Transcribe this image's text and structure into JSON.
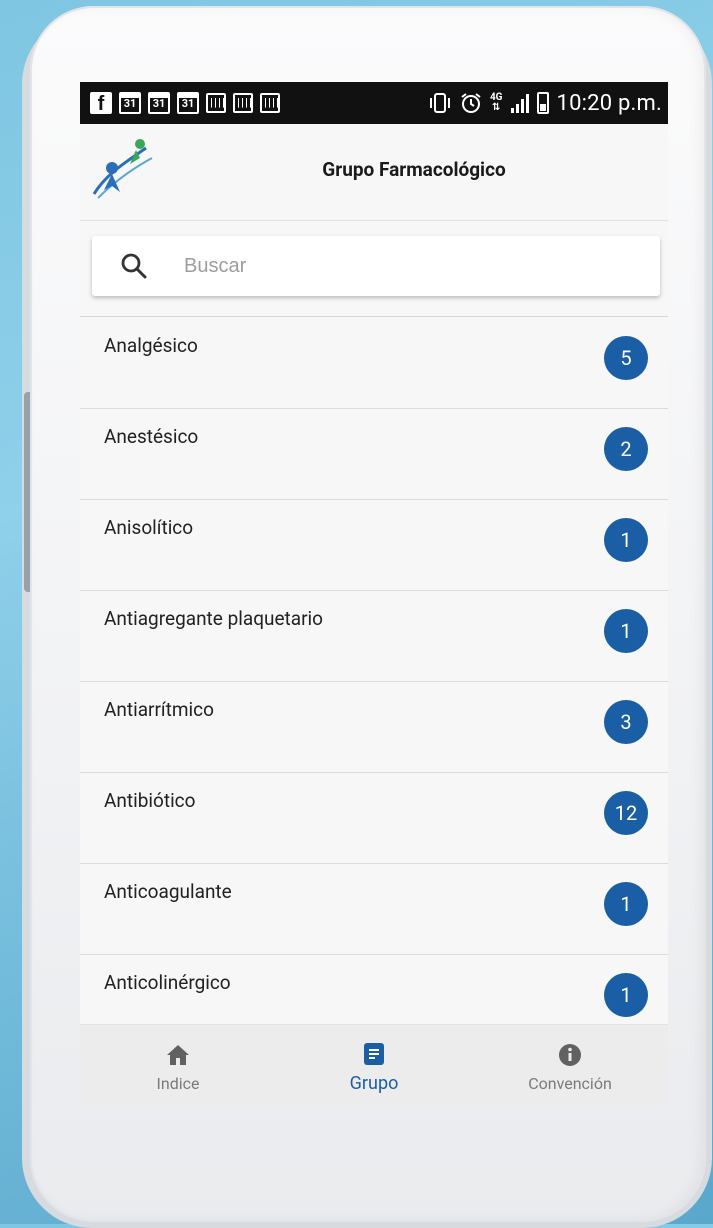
{
  "status_bar": {
    "time": "10:20 p.m.",
    "network_label": "4G",
    "calendar_day": "31",
    "icons": [
      "facebook-icon",
      "calendar-icon",
      "calendar-icon",
      "calendar-icon",
      "calendar-small-icon",
      "calendar-small-icon",
      "calendar-small-icon",
      "vibrate-icon",
      "alarm-icon",
      "network-4g-icon",
      "signal-icon",
      "battery-icon"
    ]
  },
  "header": {
    "title": "Grupo Farmacológico",
    "logo": "app-logo-icon"
  },
  "search": {
    "placeholder": "Buscar",
    "value": "",
    "icon": "search-icon"
  },
  "list": {
    "items": [
      {
        "label": "Analgésico",
        "count": "5"
      },
      {
        "label": "Anestésico",
        "count": "2"
      },
      {
        "label": "Anisolítico",
        "count": "1"
      },
      {
        "label": "Antiagregante plaquetario",
        "count": "1"
      },
      {
        "label": "Antiarrítmico",
        "count": "3"
      },
      {
        "label": "Antibiótico",
        "count": "12"
      },
      {
        "label": "Anticoagulante",
        "count": "1"
      },
      {
        "label": "Anticolinérgico",
        "count": "1"
      }
    ]
  },
  "bottom_nav": {
    "items": [
      {
        "label": "Indice",
        "icon": "home-icon",
        "active": false
      },
      {
        "label": "Grupo",
        "icon": "document-icon",
        "active": true
      },
      {
        "label": "Convención",
        "icon": "info-icon",
        "active": false
      }
    ]
  },
  "colors": {
    "accent": "#1a5fa6",
    "badge": "#1a5fa6",
    "status_bar": "#111111",
    "background": "#f7f7f7"
  }
}
